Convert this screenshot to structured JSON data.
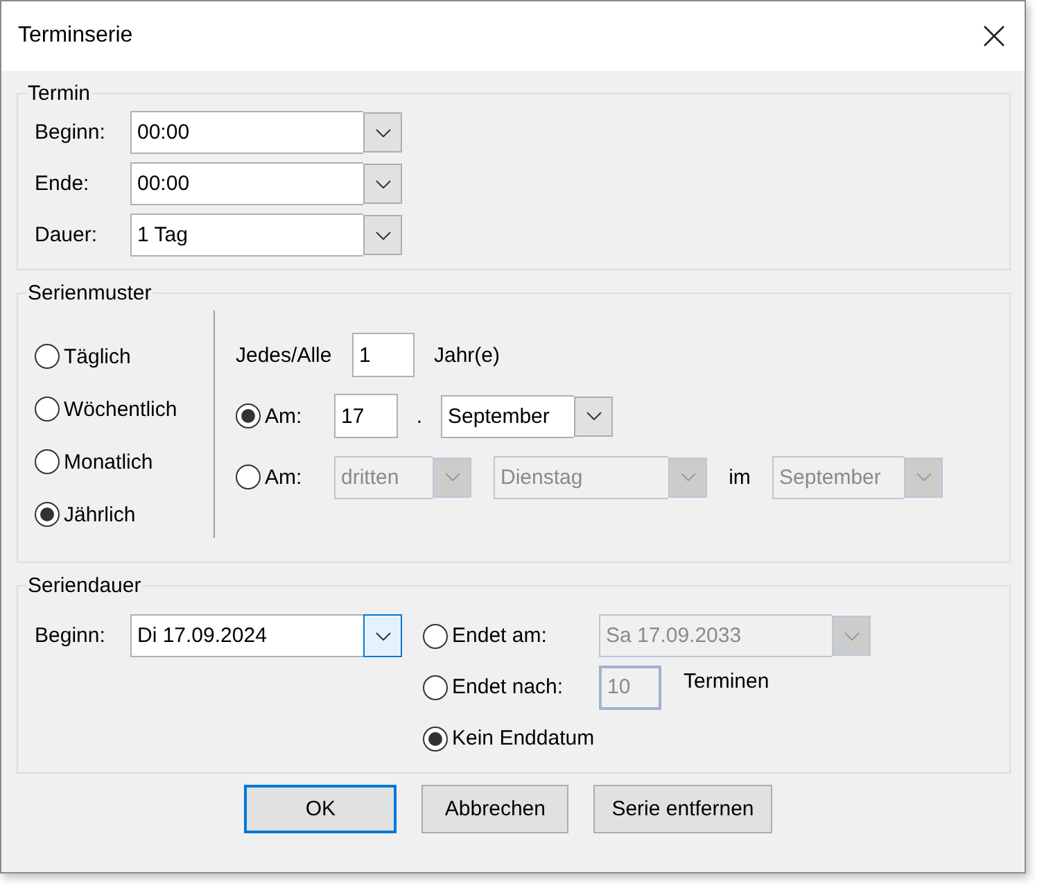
{
  "window": {
    "title": "Terminserie"
  },
  "termin": {
    "legend": "Termin",
    "fields": [
      {
        "label": "Beginn:",
        "value": "00:00"
      },
      {
        "label": "Ende:",
        "value": "00:00"
      },
      {
        "label": "Dauer:",
        "value": "1 Tag"
      }
    ]
  },
  "serienmuster": {
    "legend": "Serienmuster",
    "frequencies": [
      {
        "label": "Täglich",
        "selected": false
      },
      {
        "label": "Wöchentlich",
        "selected": false
      },
      {
        "label": "Monatlich",
        "selected": false
      },
      {
        "label": "Jährlich",
        "selected": true
      }
    ],
    "interval": {
      "label": "Jedes/Alle",
      "value": "1",
      "unit": "Jahr(e)"
    },
    "options": [
      {
        "kind": "date",
        "label": "Am:",
        "selected": true,
        "disabled": false,
        "day": "17",
        "separator": ".",
        "month": "September"
      },
      {
        "kind": "weekday",
        "label": "Am:",
        "selected": false,
        "disabled": true,
        "ordinal": "dritten",
        "weekday": "Dienstag",
        "in_label": "im",
        "month": "September"
      }
    ]
  },
  "seriendauer": {
    "legend": "Seriendauer",
    "start": {
      "label": "Beginn:",
      "value": "Di 17.09.2024",
      "focused": true
    },
    "ends": [
      {
        "kind": "date",
        "label": "Endet am:",
        "selected": false,
        "disabled": true,
        "value": "Sa 17.09.2033"
      },
      {
        "kind": "count",
        "label": "Endet nach:",
        "selected": false,
        "disabled": true,
        "value": "10",
        "unit": "Terminen"
      },
      {
        "kind": "none",
        "label": "Kein Enddatum",
        "selected": true
      }
    ]
  },
  "buttons": [
    {
      "label": "OK",
      "default": true
    },
    {
      "label": "Abbrechen",
      "default": false
    },
    {
      "label": "Serie entfernen",
      "default": false
    }
  ]
}
